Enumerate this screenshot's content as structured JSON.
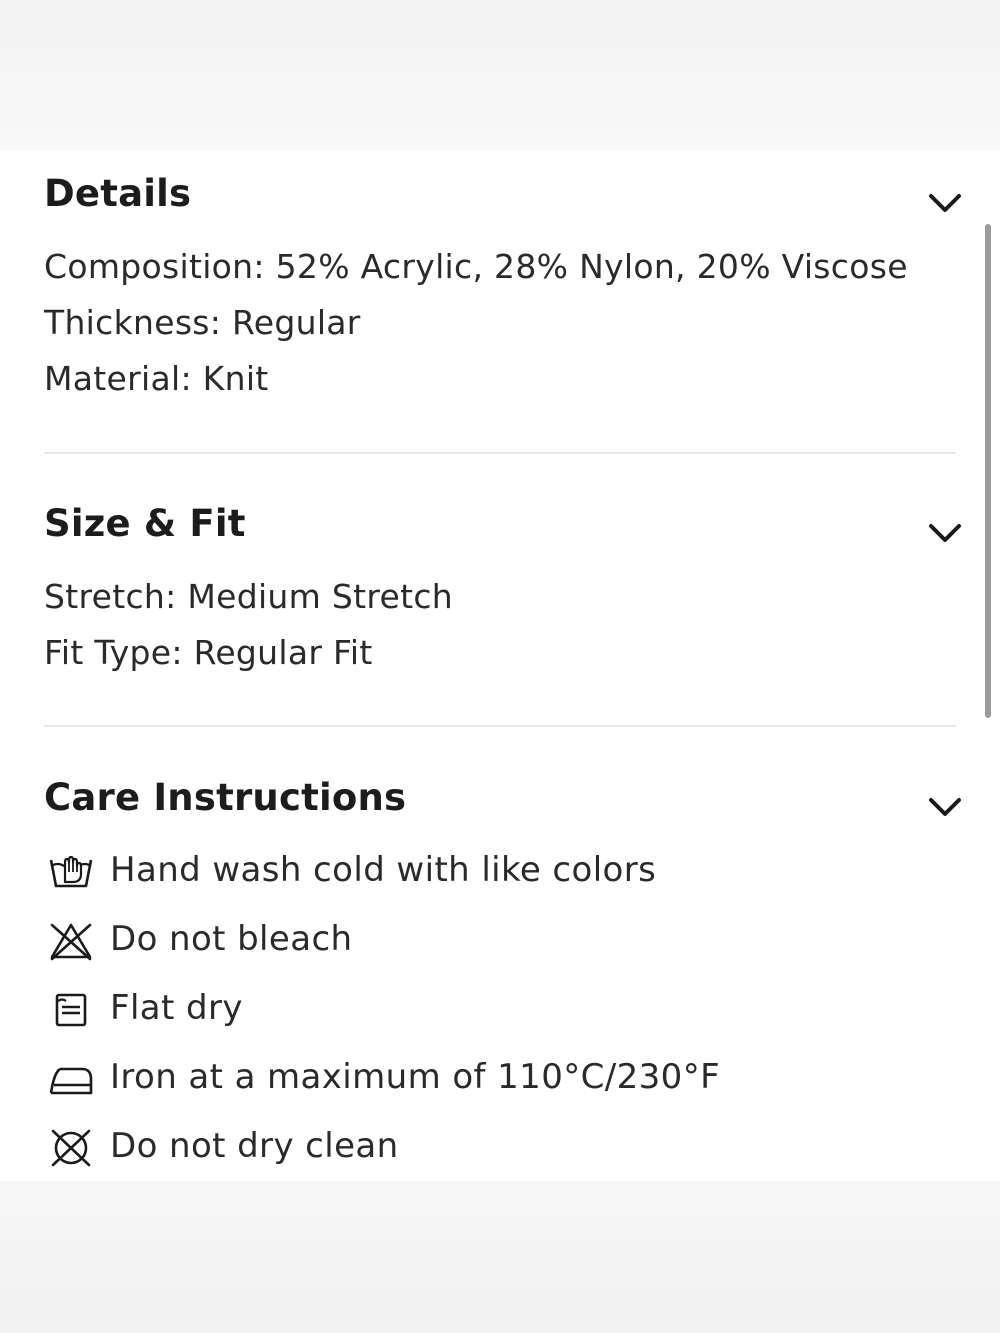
{
  "details": {
    "title": "Details",
    "lines": [
      "Composition: 52% Acrylic, 28% Nylon, 20% Viscose",
      "Thickness: Regular",
      "Material: Knit"
    ]
  },
  "size_fit": {
    "title": "Size & Fit",
    "lines": [
      "Stretch: Medium Stretch",
      "Fit Type: Regular Fit"
    ]
  },
  "care": {
    "title": "Care Instructions",
    "items": [
      {
        "icon": "hand-wash-icon",
        "text": "Hand wash cold with like colors"
      },
      {
        "icon": "do-not-bleach-icon",
        "text": "Do not bleach"
      },
      {
        "icon": "flat-dry-icon",
        "text": "Flat dry"
      },
      {
        "icon": "iron-icon",
        "text": "Iron at a maximum of 110°C/230°F"
      },
      {
        "icon": "do-not-dry-clean-icon",
        "text": "Do not dry clean"
      }
    ]
  },
  "icons": {
    "expand": "chevron-down-icon"
  },
  "colors": {
    "text": "#1a1a1a",
    "divider": "#e9e9e9",
    "scrollbar": "#9a9a9a",
    "background": "#ffffff"
  }
}
